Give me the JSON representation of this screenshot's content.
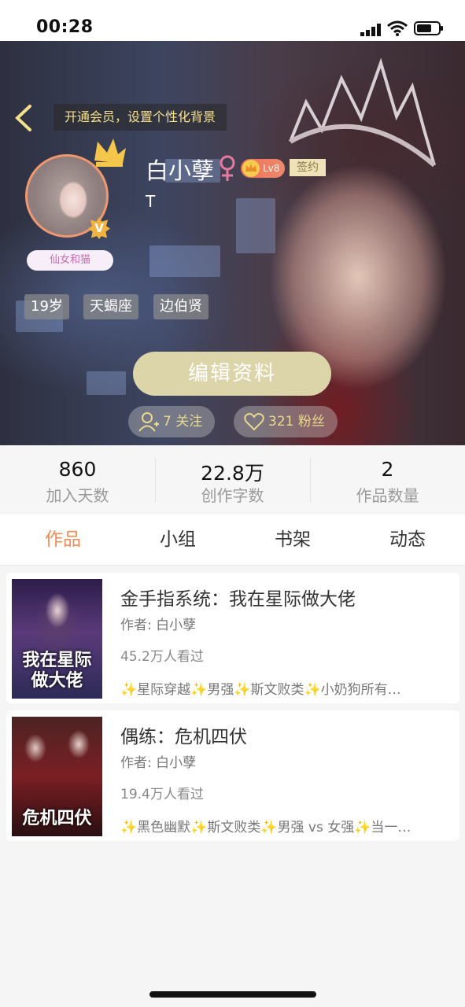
{
  "status_bar": {
    "time": "00:28"
  },
  "header": {
    "member_tip": "开通会员，设置个性化背景",
    "username": "白小孽",
    "level": "Lv8",
    "sign_badge": "签约",
    "bio": "T",
    "nick_badge": "仙女和猫",
    "v_badge": "V",
    "tags": [
      "19岁",
      "天蝎座",
      "边伯贤"
    ],
    "edit_button": "编辑资料",
    "following": "7 关注",
    "followers": "321 粉丝"
  },
  "stats": [
    {
      "value": "860",
      "label": "加入天数"
    },
    {
      "value": "22.8万",
      "label": "创作字数"
    },
    {
      "value": "2",
      "label": "作品数量"
    }
  ],
  "tabs": [
    "作品",
    "小组",
    "书架",
    "动态"
  ],
  "active_tab": "作品",
  "books": [
    {
      "title": "金手指系统：我在星际做大佬",
      "author": "作者: 白小孽",
      "views": "45.2万人看过",
      "tags": "✨星际穿越✨男强✨斯文败类✨小奶狗所有…",
      "cover_text": "我在星际做大佬"
    },
    {
      "title": "偶练：危机四伏",
      "author": "作者: 白小孽",
      "views": "19.4万人看过",
      "tags": "✨黑色幽默✨斯文败类✨男强 vs 女强✨当一…",
      "cover_text": "危机四伏"
    }
  ],
  "colors": {
    "accent": "#ef8c5a",
    "tip_text": "#f6e08a",
    "edit_button": "#ddd5aa",
    "level_badge": "#f16f5b"
  },
  "icons": [
    "back-arrow-icon",
    "female-icon",
    "crown-icon",
    "add-user-icon",
    "heart-icon",
    "signal-icon",
    "wifi-icon",
    "battery-icon"
  ]
}
